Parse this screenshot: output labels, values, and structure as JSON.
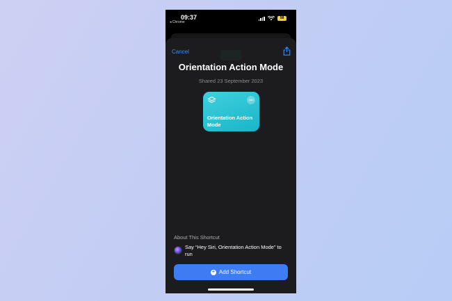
{
  "status": {
    "time": "09:37",
    "back_app": "◂ Chrome",
    "battery": "58"
  },
  "sheet": {
    "cancel_label": "Cancel",
    "title": "Orientation Action Mode",
    "shared_date": "Shared 23 September 2023"
  },
  "card": {
    "label": "Orientation Action Mode",
    "color": "#2cc4d4"
  },
  "about": {
    "heading": "About This Shortcut",
    "siri_text": "Say “Hey Siri, Orientation Action Mode” to run"
  },
  "add_button": {
    "label": "Add Shortcut",
    "color": "#3e7cf3"
  },
  "icons": [
    "signal-icon",
    "wifi-icon",
    "battery-icon",
    "share-icon",
    "layers-icon",
    "more-icon",
    "siri-icon",
    "plus-icon"
  ]
}
